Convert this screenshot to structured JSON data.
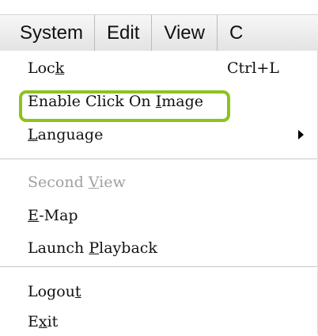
{
  "menubar": {
    "items": [
      {
        "label": "System"
      },
      {
        "label": "Edit"
      },
      {
        "label": "View"
      },
      {
        "label": "C"
      }
    ]
  },
  "menu": {
    "groups": [
      [
        {
          "label": "Lock",
          "shortcut": "Ctrl+L",
          "underline": "k"
        },
        {
          "label": "Enable Click On Image",
          "underline": "I",
          "highlighted": true
        },
        {
          "label": "Language",
          "underline": "L",
          "submenu": true
        }
      ],
      [
        {
          "label": "Second View",
          "underline": "V",
          "disabled": true
        },
        {
          "label": "E-Map",
          "underline": "E"
        },
        {
          "label": "Launch Playback",
          "underline": "P"
        }
      ],
      [
        {
          "label": "Logout",
          "underline": "t"
        },
        {
          "label": "Exit",
          "underline": "x"
        }
      ]
    ]
  },
  "colors": {
    "highlight": "#8dc21f",
    "disabled_text": "#a0a0a0"
  }
}
